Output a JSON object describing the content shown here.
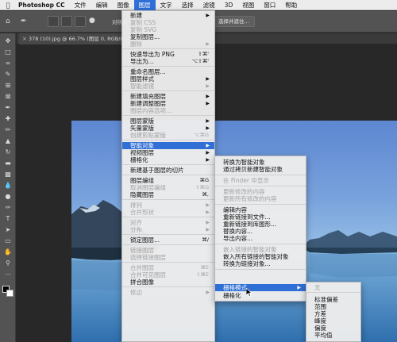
{
  "menubar": {
    "app": "Photoshop CC",
    "items": [
      "文件",
      "编辑",
      "图像",
      "图层",
      "文字",
      "选择",
      "滤镜",
      "3D",
      "视图",
      "窗口",
      "帮助"
    ]
  },
  "options_bar": {
    "checkbox_label": "对所有",
    "select_subject_button": "选择并遮住..."
  },
  "document": {
    "tab_label": "378 (10).jpg @ 66.7% (图层 0, RGB/8) *"
  },
  "layer_menu": {
    "items": [
      {
        "label": "新建",
        "arrow": true
      },
      {
        "label": "复制 CSS",
        "disabled": true
      },
      {
        "label": "复制 SVG",
        "disabled": true
      },
      {
        "label": "复制图层..."
      },
      {
        "label": "删除",
        "arrow": true,
        "disabled": true
      },
      {
        "sep": true
      },
      {
        "label": "快速导出为 PNG",
        "shortcut": "⇧⌘'"
      },
      {
        "label": "导出为...",
        "shortcut": "⌥⇧⌘'"
      },
      {
        "sep": true
      },
      {
        "label": "重命名图层..."
      },
      {
        "label": "图层样式",
        "arrow": true
      },
      {
        "label": "智能滤镜",
        "arrow": true,
        "disabled": true
      },
      {
        "sep": true
      },
      {
        "label": "新建填充图层",
        "arrow": true
      },
      {
        "label": "新建调整图层",
        "arrow": true
      },
      {
        "label": "图层内容选项...",
        "disabled": true
      },
      {
        "sep": true
      },
      {
        "label": "图层蒙版",
        "arrow": true
      },
      {
        "label": "矢量蒙版",
        "arrow": true
      },
      {
        "label": "创建剪贴蒙版",
        "shortcut": "⌥⌘G",
        "disabled": true
      },
      {
        "sep": true
      },
      {
        "label": "智能对象",
        "arrow": true,
        "highlighted": true
      },
      {
        "label": "视频图层",
        "arrow": true
      },
      {
        "label": "栅格化",
        "arrow": true
      },
      {
        "sep": true
      },
      {
        "label": "新建基于图层的切片"
      },
      {
        "sep": true
      },
      {
        "label": "图层编组",
        "shortcut": "⌘G"
      },
      {
        "label": "取消图层编组",
        "shortcut": "⇧⌘G",
        "disabled": true
      },
      {
        "label": "隐藏图层",
        "shortcut": "⌘,"
      },
      {
        "sep": true
      },
      {
        "label": "排列",
        "arrow": true,
        "disabled": true
      },
      {
        "label": "合并形状",
        "arrow": true,
        "disabled": true
      },
      {
        "sep": true
      },
      {
        "label": "对齐",
        "arrow": true,
        "disabled": true
      },
      {
        "label": "分布",
        "arrow": true,
        "disabled": true
      },
      {
        "sep": true
      },
      {
        "label": "锁定图层...",
        "shortcut": "⌘/"
      },
      {
        "sep": true
      },
      {
        "label": "链接图层",
        "disabled": true
      },
      {
        "label": "选择链接图层",
        "disabled": true
      },
      {
        "sep": true
      },
      {
        "label": "合并图层",
        "shortcut": "⌘E",
        "disabled": true
      },
      {
        "label": "合并可见图层",
        "shortcut": "⇧⌘E",
        "disabled": true
      },
      {
        "label": "拼合图像"
      },
      {
        "sep": true
      },
      {
        "label": "修边",
        "arrow": true,
        "disabled": true
      }
    ]
  },
  "smart_object_menu": {
    "items": [
      {
        "label": "转换为智能对象"
      },
      {
        "label": "通过拷贝新建智能对象"
      },
      {
        "sep": true
      },
      {
        "label": "在 Finder 中显示",
        "disabled": true
      },
      {
        "sep": true
      },
      {
        "label": "更新修改的内容",
        "disabled": true
      },
      {
        "label": "更新所有修改的内容",
        "disabled": true
      },
      {
        "sep": true
      },
      {
        "label": "编辑内容"
      },
      {
        "label": "重新链接到文件..."
      },
      {
        "label": "重新链接到库图形..."
      },
      {
        "label": "替换内容..."
      },
      {
        "label": "导出内容..."
      },
      {
        "sep": true
      },
      {
        "label": "嵌入链接的智能对象",
        "disabled": true
      },
      {
        "label": "嵌入所有链接的智能对象"
      },
      {
        "label": "转换为链接对象..."
      },
      {
        "sep": true
      },
      {
        "label": "栅格模式",
        "arrow": true,
        "highlighted": true
      },
      {
        "label": "栅格化"
      }
    ]
  },
  "stack_mode_menu": {
    "items": [
      {
        "label": "无",
        "disabled": true
      },
      {
        "sep": true
      },
      {
        "label": "标准偏差"
      },
      {
        "label": "范围"
      },
      {
        "label": "方差"
      },
      {
        "label": "峰度"
      },
      {
        "label": "偏度"
      },
      {
        "label": "平均值"
      }
    ]
  },
  "colors": {
    "highlight": "#2f6fd6",
    "menu_bg": "#ececec",
    "panel_bg": "#535353",
    "app_bg": "#282828"
  }
}
